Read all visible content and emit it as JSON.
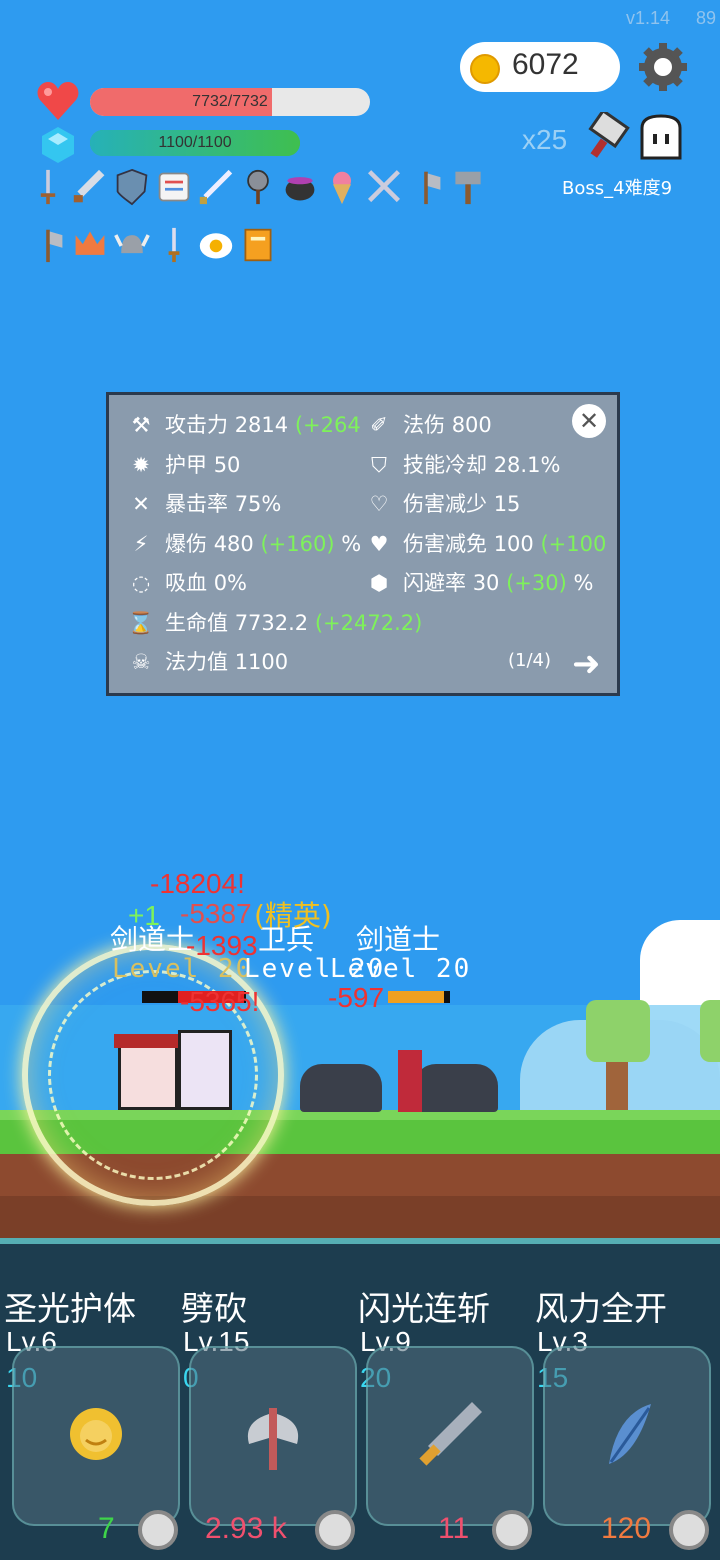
{
  "header": {
    "version": "v1.14",
    "fps": "89",
    "coins": "6072",
    "hp": "7732/7732",
    "hp_fraction": 0.65,
    "mp": "1100/1100",
    "multiplier": "x25",
    "boss_label": "Boss_4难度9"
  },
  "equipment_icons": [
    "dagger-icon",
    "sword-icon",
    "shield-icon",
    "scroll-icon",
    "blade-icon",
    "mace-icon",
    "cauldron-icon",
    "ice-cream-icon",
    "crossed-swords-icon",
    "axe-icon",
    "hammer-icon",
    "axe-icon",
    "crown-icon",
    "viking-helmet-icon",
    "short-sword-icon",
    "fried-egg-icon",
    "book-icon"
  ],
  "stats_panel": {
    "left": [
      {
        "icon": "axe-stat-icon",
        "label": "攻击力",
        "value": "2814",
        "bonus": "(+264",
        "suffix": ""
      },
      {
        "icon": "sun-icon",
        "label": "护甲",
        "value": "50",
        "bonus": "",
        "suffix": ""
      },
      {
        "icon": "crit-icon",
        "label": "暴击率",
        "value": "75%",
        "bonus": "",
        "suffix": ""
      },
      {
        "icon": "lightning-icon",
        "label": "爆伤",
        "value": "480",
        "bonus": "(+160)",
        "suffix": "%"
      },
      {
        "icon": "lifesteal-icon",
        "label": "吸血",
        "value": "0%",
        "bonus": "",
        "suffix": ""
      },
      {
        "icon": "hourglass-icon",
        "label": "生命值",
        "value": "7732.2",
        "bonus": "(+2472.2)",
        "suffix": ""
      },
      {
        "icon": "skull-icon",
        "label": "法力值",
        "value": "1100",
        "bonus": "",
        "suffix": ""
      }
    ],
    "right": [
      {
        "icon": "wand-icon",
        "label": "法伤",
        "value": "800",
        "bonus": "",
        "suffix": ""
      },
      {
        "icon": "shield-stat-icon",
        "label": "技能冷却",
        "value": "28.1%",
        "bonus": "",
        "suffix": ""
      },
      {
        "icon": "heart-shield-icon",
        "label": "伤害减少",
        "value": "15",
        "bonus": "",
        "suffix": ""
      },
      {
        "icon": "heart-icon",
        "label": "伤害减免",
        "value": "100",
        "bonus": "(+100",
        "suffix": ""
      },
      {
        "icon": "gem-icon",
        "label": "闪避率",
        "value": "30",
        "bonus": "(+30)",
        "suffix": "%"
      }
    ],
    "page": "(1/4)",
    "close": "✕",
    "next": "➜"
  },
  "battle": {
    "damage_numbers": [
      "-18204!",
      "-5387",
      "-1393",
      "-5365!",
      "-597"
    ],
    "heal_numbers": [
      "+1"
    ],
    "enemy_names": [
      "剑道士",
      "卫兵",
      "剑道士"
    ],
    "elite_tag": "(精英)",
    "levels": [
      "Level 20",
      "Level 20",
      "Level 20"
    ]
  },
  "skills": [
    {
      "name": "圣光护体",
      "level": "Lv.6",
      "cost": "10",
      "value": "7",
      "value_color": "#3fd44a",
      "icon": "angel-icon"
    },
    {
      "name": "劈砍",
      "level": "Lv.15",
      "cost": "0",
      "value": "2.93 k",
      "value_color": "#f0506e",
      "icon": "battle-axe-icon"
    },
    {
      "name": "闪光连斩",
      "level": "Lv.9",
      "cost": "20",
      "value": "11",
      "value_color": "#f0506e",
      "icon": "sword-skill-icon"
    },
    {
      "name": "风力全开",
      "level": "Lv.3",
      "cost": "15",
      "value": "120",
      "value_color": "#f07a40",
      "icon": "feather-icon"
    }
  ]
}
